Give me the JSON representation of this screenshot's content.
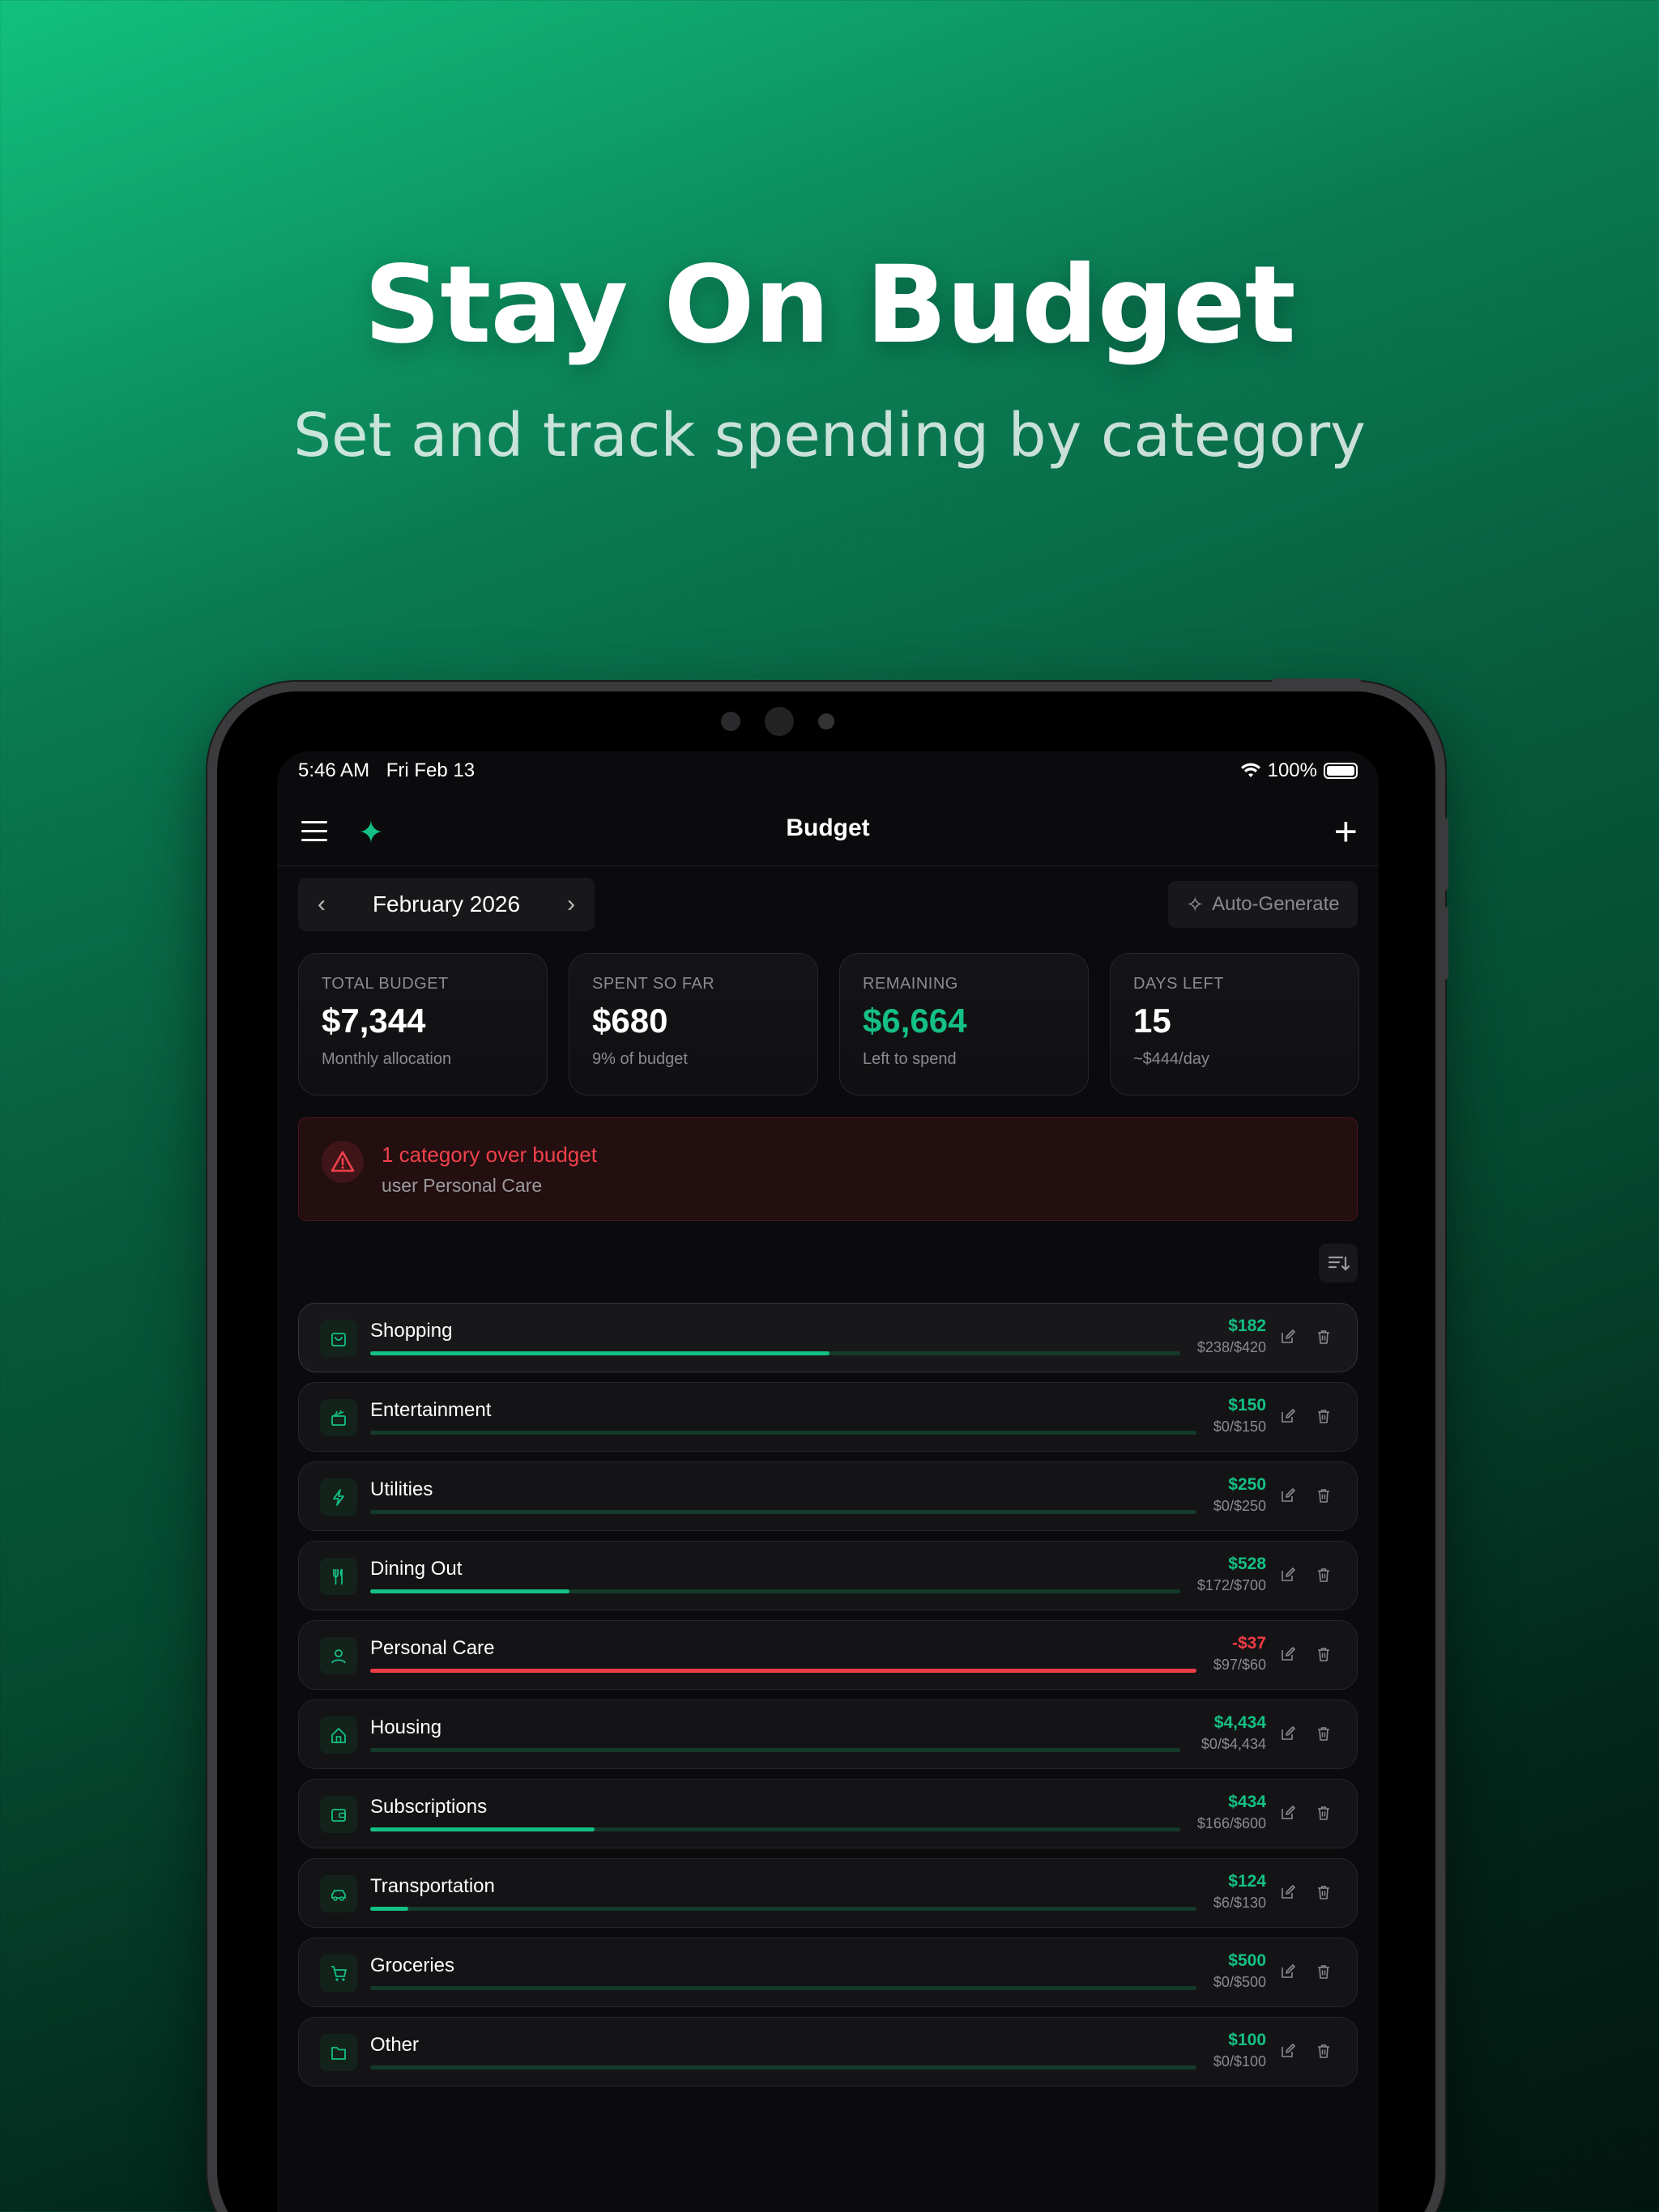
{
  "hero": {
    "title": "Stay On Budget",
    "subtitle": "Set and track spending by category"
  },
  "status_bar": {
    "time": "5:46 AM",
    "date": "Fri Feb 13",
    "battery": "100%"
  },
  "nav": {
    "title": "Budget"
  },
  "month_nav": {
    "label": "February 2026"
  },
  "auto_generate_label": "Auto-Generate",
  "summary": [
    {
      "key": "TOTAL BUDGET",
      "value": "$7,344",
      "sub": "Monthly allocation",
      "accent": false
    },
    {
      "key": "SPENT SO FAR",
      "value": "$680",
      "sub": "9% of budget",
      "accent": false
    },
    {
      "key": "REMAINING",
      "value": "$6,664",
      "sub": "Left to spend",
      "accent": true
    },
    {
      "key": "DAYS LEFT",
      "value": "15",
      "sub": "~$444/day",
      "accent": false
    }
  ],
  "alert": {
    "title": "1 category over budget",
    "detail": "user Personal Care"
  },
  "categories": [
    {
      "name": "Shopping",
      "remaining": "$182",
      "usage": "$238/$420",
      "progress": 0.567,
      "over": false,
      "icon": "shopping-bag-icon"
    },
    {
      "name": "Entertainment",
      "remaining": "$150",
      "usage": "$0/$150",
      "progress": 0,
      "over": false,
      "icon": "clapperboard-icon"
    },
    {
      "name": "Utilities",
      "remaining": "$250",
      "usage": "$0/$250",
      "progress": 0,
      "over": false,
      "icon": "lightning-icon"
    },
    {
      "name": "Dining Out",
      "remaining": "$528",
      "usage": "$172/$700",
      "progress": 0.246,
      "over": false,
      "icon": "utensils-icon"
    },
    {
      "name": "Personal Care",
      "remaining": "-$37",
      "usage": "$97/$60",
      "progress": 1,
      "over": true,
      "icon": "user-icon"
    },
    {
      "name": "Housing",
      "remaining": "$4,434",
      "usage": "$0/$4,434",
      "progress": 0,
      "over": false,
      "icon": "home-icon"
    },
    {
      "name": "Subscriptions",
      "remaining": "$434",
      "usage": "$166/$600",
      "progress": 0.277,
      "over": false,
      "icon": "wallet-icon"
    },
    {
      "name": "Transportation",
      "remaining": "$124",
      "usage": "$6/$130",
      "progress": 0.046,
      "over": false,
      "icon": "car-icon"
    },
    {
      "name": "Groceries",
      "remaining": "$500",
      "usage": "$0/$500",
      "progress": 0,
      "over": false,
      "icon": "cart-icon"
    },
    {
      "name": "Other",
      "remaining": "$100",
      "usage": "$0/$100",
      "progress": 0,
      "over": false,
      "icon": "folder-icon"
    }
  ],
  "colors": {
    "accent": "#14c084",
    "danger": "#ef3b45",
    "background": "#0b0b0d"
  }
}
